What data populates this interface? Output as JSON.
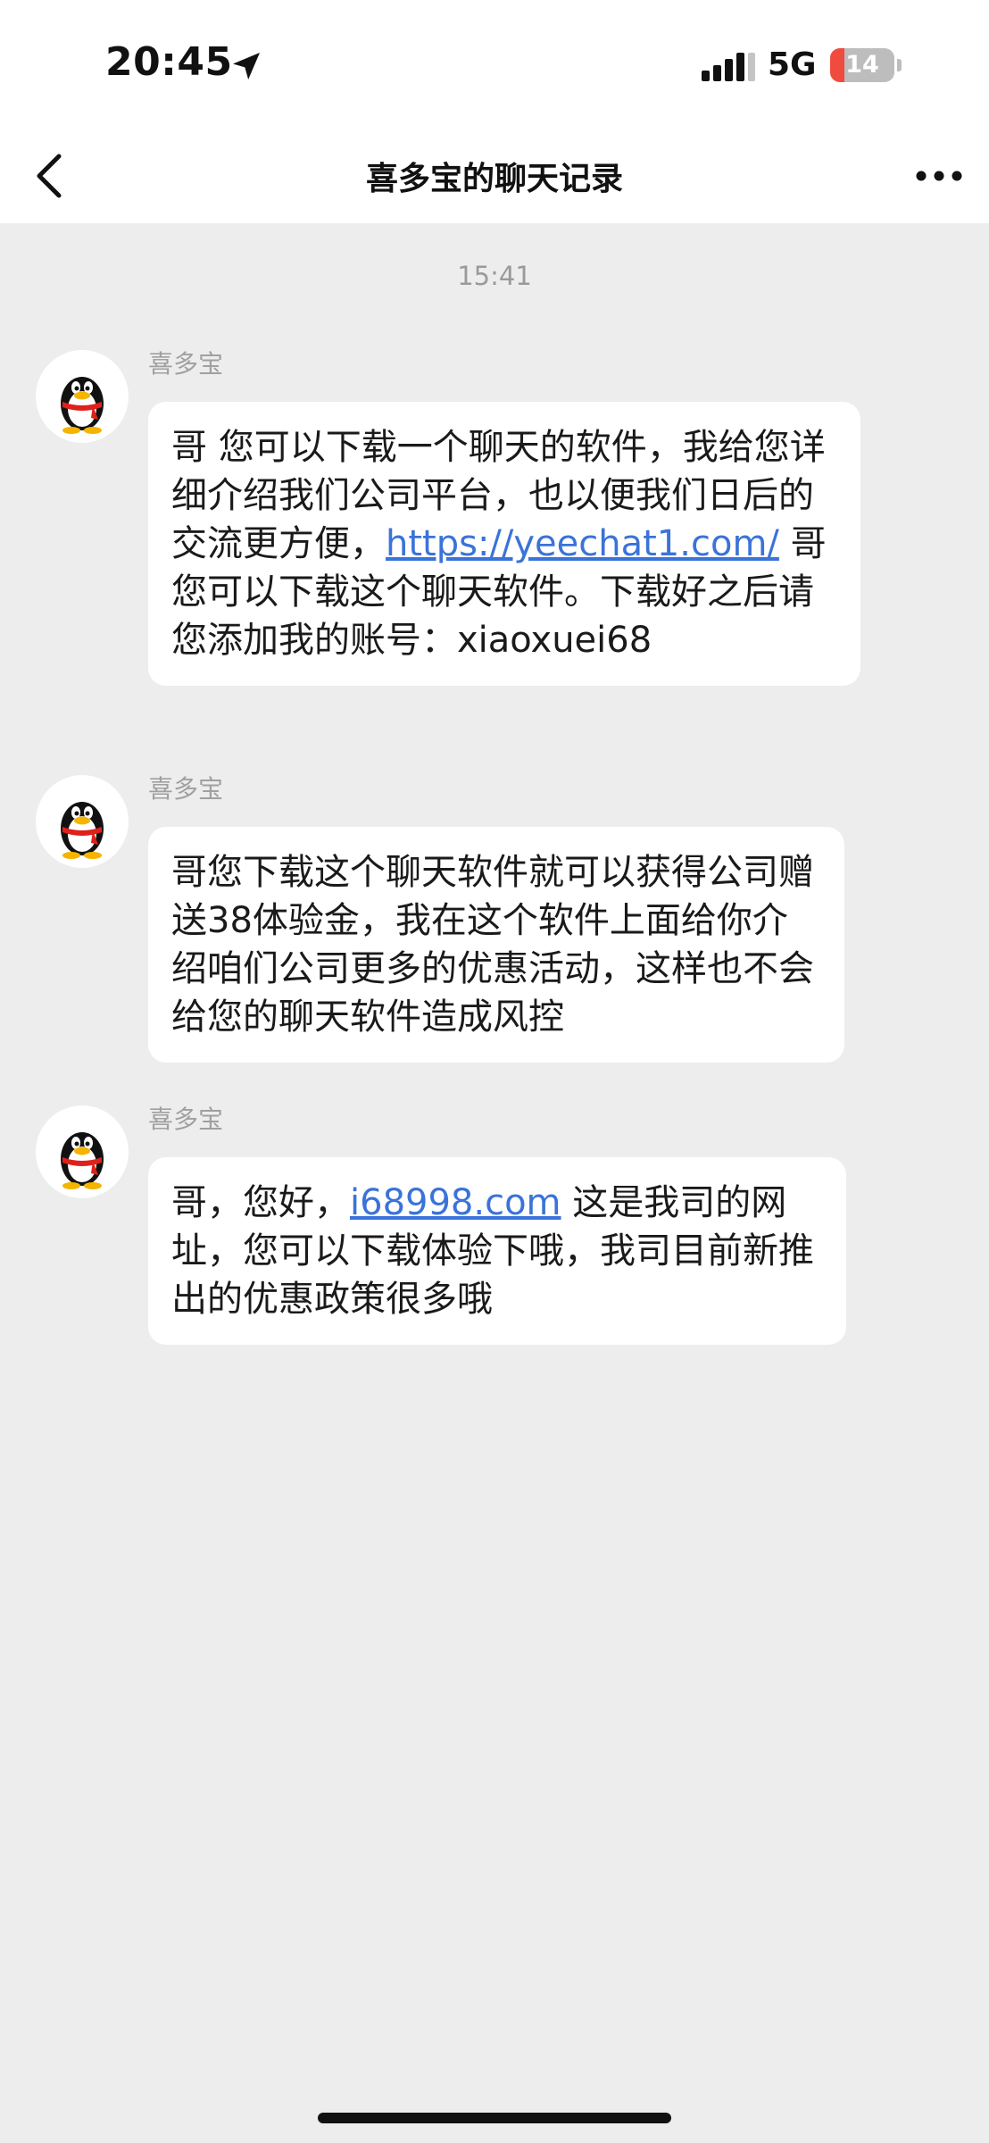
{
  "status_bar": {
    "time": "20:45",
    "network": "5G",
    "battery_level": "14",
    "battery_fraction": 0.14,
    "location_icon": "location-arrow-icon",
    "signal_icon": "cellular-signal-icon"
  },
  "nav": {
    "title": "喜多宝的聊天记录",
    "back_icon": "chevron-left-icon",
    "more_icon": "ellipsis-icon"
  },
  "chat": {
    "timestamp": "15:41",
    "messages": [
      {
        "sender": "喜多宝",
        "parts": [
          {
            "text": "哥 您可以下载一个聊天的软件，我给您详细介绍我们公司平台，也以便我们日后的交流更方便，"
          },
          {
            "link": "https://yeechat1.com/"
          },
          {
            "text": " 哥您可以下载这个聊天软件。下载好之后请您添加我的账号：xiaoxuei68"
          }
        ]
      },
      {
        "sender": "喜多宝",
        "parts": [
          {
            "text": "哥您下载这个聊天软件就可以获得公司赠送38体验金，我在这个软件上面给你介绍咱们公司更多的优惠活动，这样也不会给您的聊天软件造成风控"
          }
        ]
      },
      {
        "sender": "喜多宝",
        "parts": [
          {
            "text": "哥，您好，"
          },
          {
            "link": "i68998.com"
          },
          {
            "text": " 这是我司的网址，您可以下载体验下哦，我司目前新推出的优惠政策很多哦"
          }
        ]
      }
    ]
  },
  "colors": {
    "background": "#ededed",
    "bubble": "#ffffff",
    "link": "#3a73d9",
    "battery_low": "#f04b3f"
  }
}
